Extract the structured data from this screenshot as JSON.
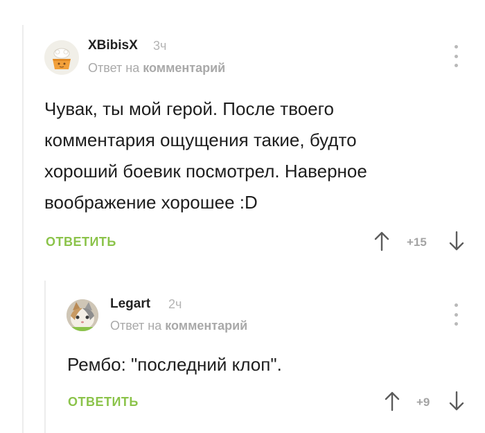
{
  "comments": [
    {
      "author": "XBibisX",
      "time": "3ч",
      "reply_prefix": "Ответ на",
      "reply_target": "комментарий",
      "text": "Чувак, ты мой герой. После твоего комментария ощущения такие, будто хороший боевик посмотрел. Наверное воображение хорошее :D",
      "reply_label": "ОТВЕТИТЬ",
      "score": "+15",
      "avatar_icon": "cupcake-avatar-icon"
    },
    {
      "author": "Legart",
      "time": "2ч",
      "reply_prefix": "Ответ на",
      "reply_target": "комментарий",
      "text": "Рембо: \"последний клоп\".",
      "reply_label": "ОТВЕТИТЬ",
      "score": "+9",
      "avatar_icon": "cat-avatar-icon"
    }
  ],
  "colors": {
    "accent_green": "#8bc34a",
    "muted_gray": "#a9a9a9"
  }
}
